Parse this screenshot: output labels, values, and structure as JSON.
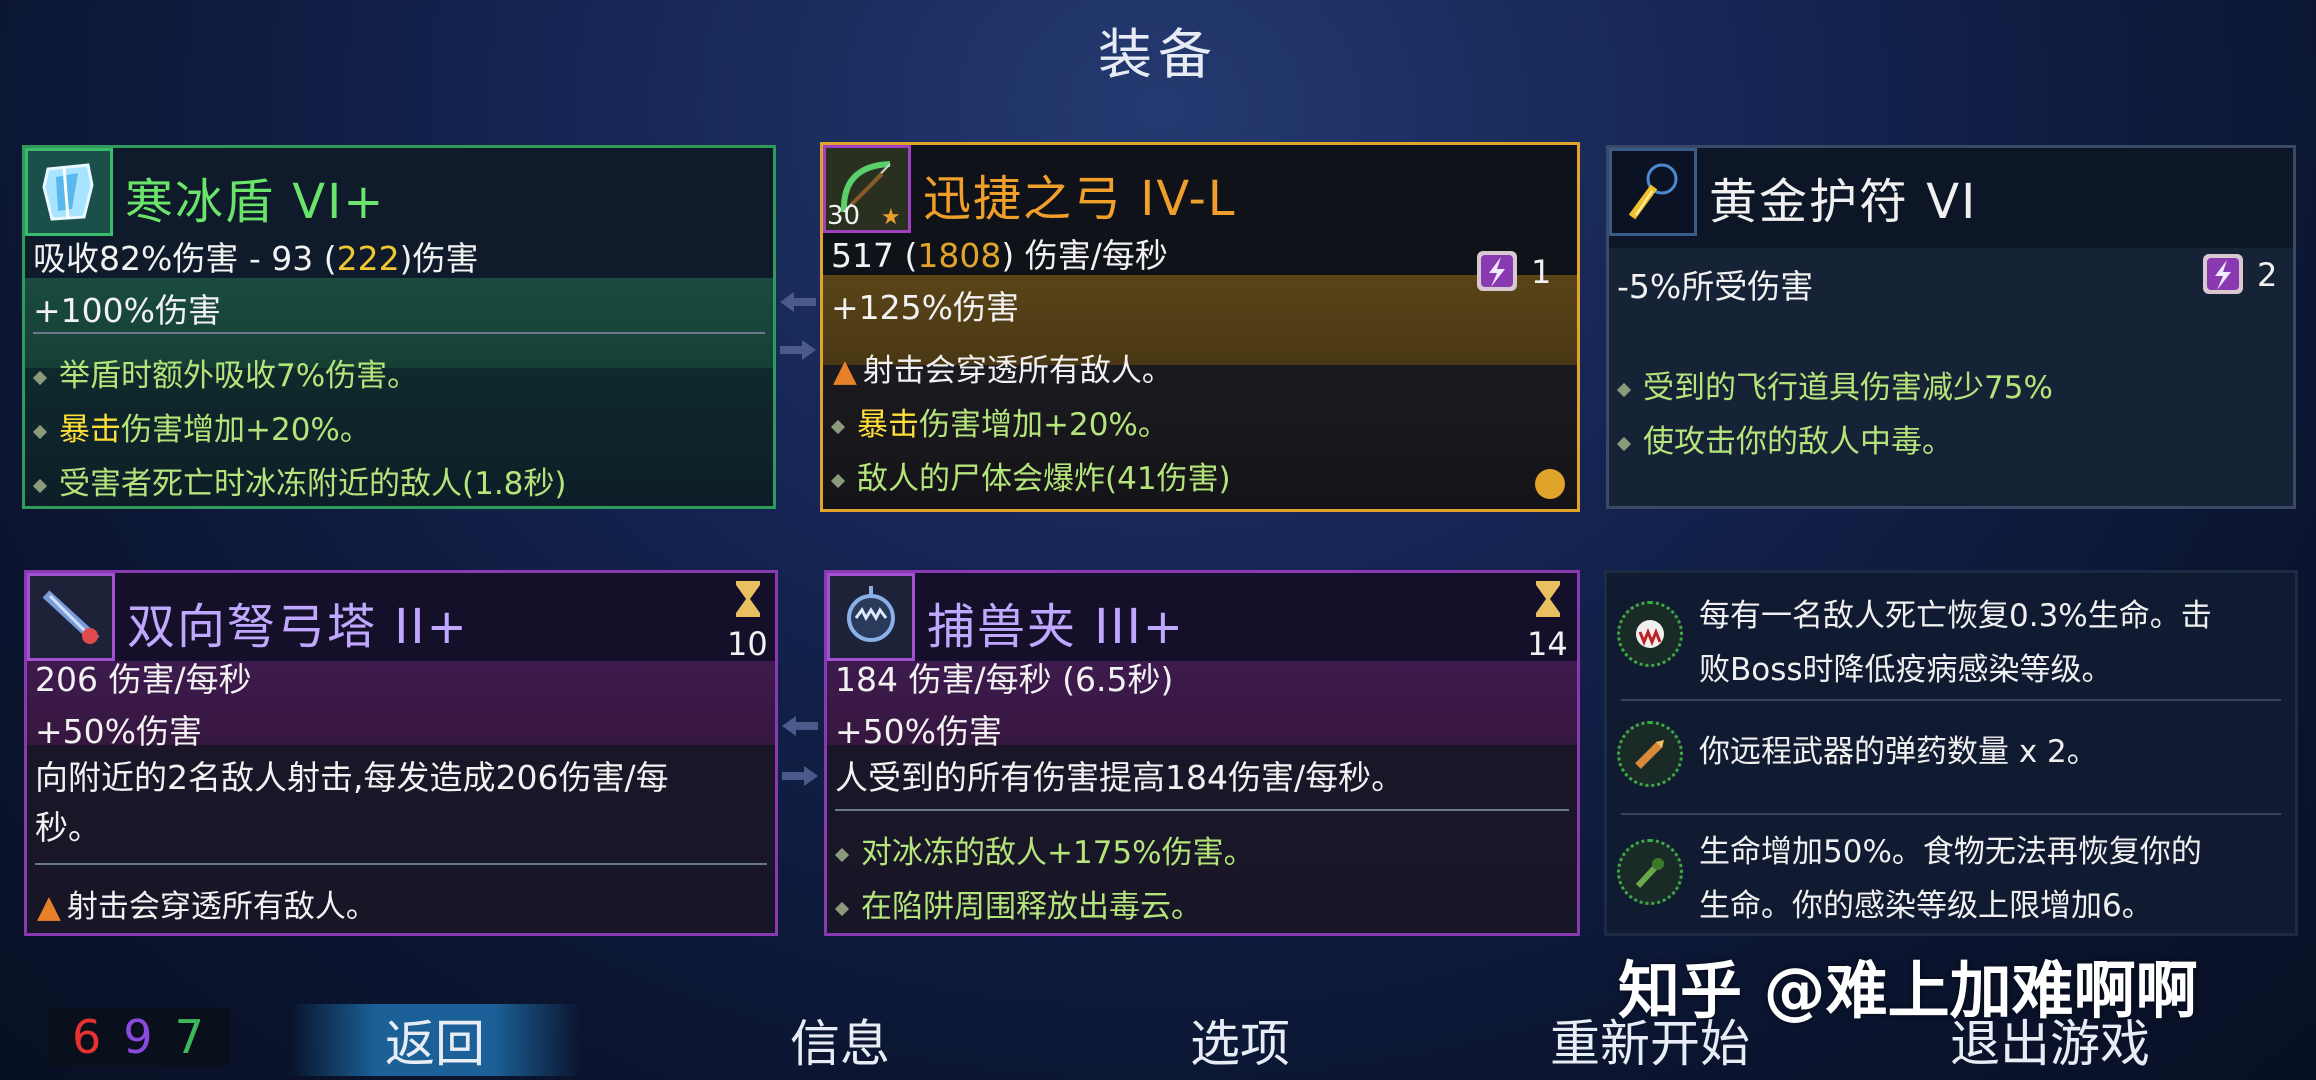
{
  "title": "装备",
  "colors": {
    "stat_red": "#e83232",
    "stat_purple": "#8a4ae0",
    "stat_green": "#3ab85a"
  },
  "cards": {
    "ice_shield": {
      "icon": "ice-shield-icon",
      "name": "寒冰盾 VI+",
      "line1_a": "吸收82%伤害 - 93 (",
      "line1_b": "222",
      "line1_c": ")伤害",
      "line2": "+100%伤害",
      "traits": [
        {
          "a": "举盾时额外吸收7%伤害。"
        },
        {
          "hl": "暴击",
          "a": "伤害增加+20%。"
        },
        {
          "a": "受害者死亡时冰冻附近的敌人(1.8秒)"
        }
      ]
    },
    "bow": {
      "icon": "bow-icon",
      "level": "30",
      "name": "迅捷之弓 IV-L",
      "line1_a": "517 (",
      "line1_b": "1808",
      "line1_c": ") 伤害/每秒",
      "line2": "+125%伤害",
      "scroll_count": "1",
      "traits": [
        {
          "a": "射击会穿透所有敌人。",
          "star": true
        },
        {
          "hl": "暴击",
          "a": "伤害增加+20%。"
        },
        {
          "a": "敌人的尸体会爆炸(41伤害)"
        }
      ]
    },
    "amulet": {
      "icon": "golden-amulet-icon",
      "name": "黄金护符 VI",
      "line1": "-5%所受伤害",
      "scroll_count": "2",
      "traits": [
        {
          "a": "受到的飞行道具伤害减少75%"
        },
        {
          "a": "使攻击你的敌人中毒。"
        }
      ]
    },
    "crossbow": {
      "icon": "crossbow-turret-icon",
      "name": "双向弩弓塔 II+",
      "cooldown": "10",
      "line1": "206 伤害/每秒",
      "line2": "+50%伤害",
      "desc1": "向附近的2名敌人射击,每发造成206伤害/每",
      "desc2": "秒。",
      "traits": [
        {
          "a": "射击会穿透所有敌人。",
          "star": true
        }
      ]
    },
    "trap": {
      "icon": "wolf-trap-icon",
      "name": "捕兽夹 III+",
      "cooldown": "14",
      "line1": "184 伤害/每秒 (6.5秒)",
      "line2": "+50%伤害",
      "desc1": "人受到的所有伤害提高184伤害/每秒。",
      "traits": [
        {
          "a": "对冰冻的敌人+175%伤害。"
        },
        {
          "a": "在陷阱周围释放出毒云。"
        }
      ]
    }
  },
  "skills": [
    {
      "icon": "vampire-mutation-icon",
      "l1": "每有一名敌人死亡恢复0.3%生命。击",
      "l2": "败Boss时降低疫病感染等级。"
    },
    {
      "icon": "ammo-mutation-icon",
      "l1": "你远程武器的弹药数量 x 2。",
      "l2": ""
    },
    {
      "icon": "necromancy-mutation-icon",
      "l1": "生命增加50%。食物无法再恢复你的",
      "l2": "生命。你的感染等级上限增加6。"
    }
  ],
  "stats": {
    "brutality": "6",
    "tactics": "9",
    "survival": "7"
  },
  "menu": {
    "back": "返回",
    "info": "信息",
    "options": "选项",
    "restart": "重新开始",
    "quit": "退出游戏"
  },
  "watermark": "知乎 @难上加难啊啊"
}
